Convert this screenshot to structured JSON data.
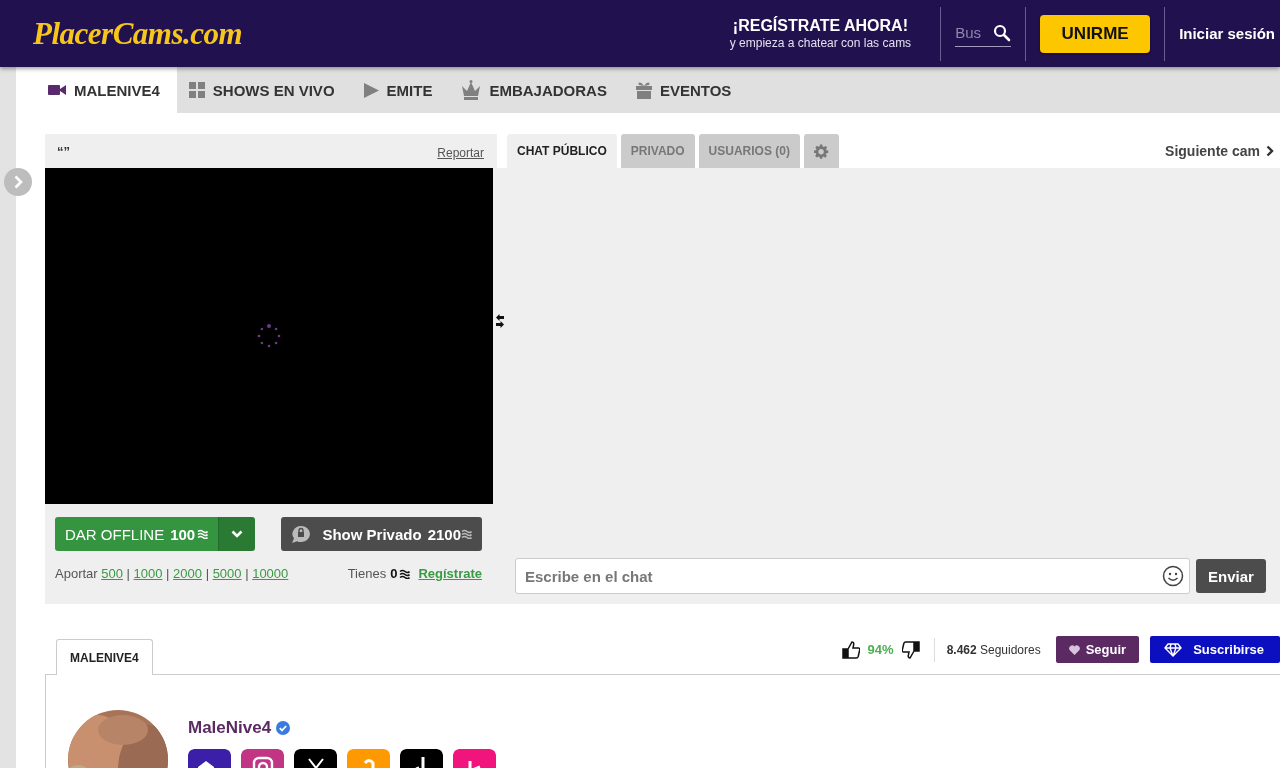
{
  "header": {
    "logo": "PlacerCams.com",
    "promo_title": "¡REGÍSTRATE AHORA!",
    "promo_subtitle": "y empieza a chatear con las cams",
    "search": {
      "placeholder": "Bus"
    },
    "join_button": "UNIRME",
    "login_link": "Iniciar sesión"
  },
  "nav": {
    "tabs": [
      {
        "label": "MALENIVE4",
        "kind": "camera",
        "selected": true
      },
      {
        "label": "SHOWS EN VIVO",
        "kind": "grid",
        "selected": false
      },
      {
        "label": "EMITE",
        "kind": "play",
        "selected": false
      },
      {
        "label": "EMBAJADORAS",
        "kind": "crown",
        "selected": false
      },
      {
        "label": "EVENTOS",
        "kind": "gift",
        "selected": false
      }
    ]
  },
  "player": {
    "title": "“”",
    "report_link": "Reportar",
    "tip_button": {
      "label": "DAR OFFLINE",
      "amount": "100"
    },
    "private_button": {
      "label": "Show Privado",
      "amount": "2100"
    },
    "tip_label": "Aportar",
    "tip_amounts": [
      "500",
      "1000",
      "2000",
      "5000",
      "10000"
    ],
    "tip_separator": "|",
    "balance_label": "Tienes",
    "balance": "0",
    "register_link": "Regístrate"
  },
  "chat": {
    "tabs": [
      {
        "label": "CHAT PÚBLICO",
        "kind": "text",
        "selected": true
      },
      {
        "label": "PRIVADO",
        "kind": "text",
        "selected": false
      },
      {
        "label": "USUARIOS (0)",
        "kind": "text",
        "selected": false
      },
      {
        "kind": "settings",
        "selected": false
      }
    ],
    "next_cam": "Siguiente cam",
    "input": {
      "placeholder": "Escribe en el chat"
    },
    "send_button": "Enviar"
  },
  "profile": {
    "tabs": [
      {
        "label": "MALENIVE4",
        "selected": true
      }
    ],
    "rating": "94%",
    "followers_count": "8.462",
    "followers_label": "Seguidores",
    "follow_button": "Seguir",
    "subscribe_button": "Suscribirse",
    "name": "MaleNive4",
    "verified": true,
    "socials": [
      {
        "kind": "website",
        "color": "#3b1fa8"
      },
      {
        "kind": "instagram",
        "color": "#c13584"
      },
      {
        "kind": "x",
        "color": "#000000"
      },
      {
        "kind": "amazon",
        "color": "#ff9900"
      },
      {
        "kind": "tiktok",
        "color": "#000000"
      },
      {
        "kind": "shop",
        "color": "#f0147c"
      }
    ]
  }
}
